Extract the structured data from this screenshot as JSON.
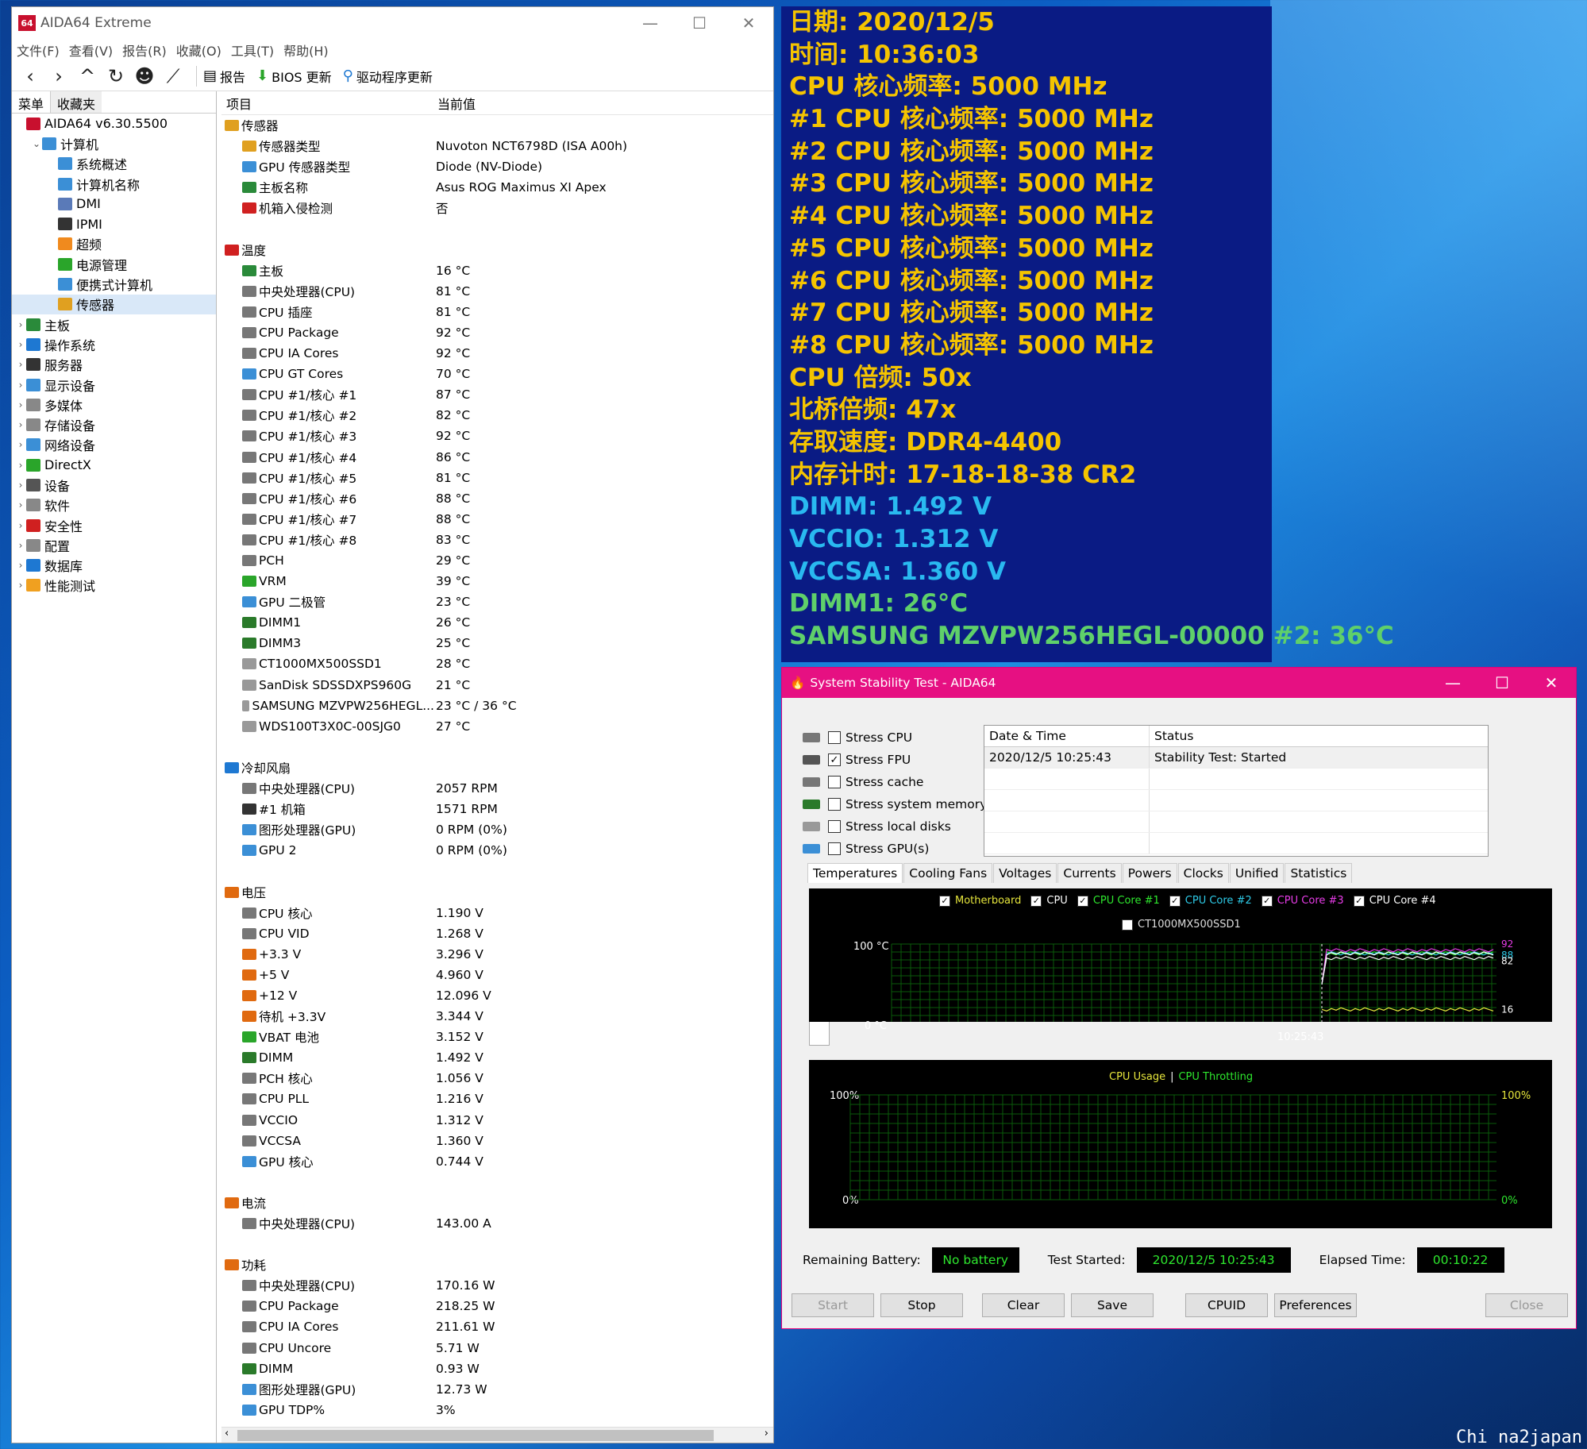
{
  "aida": {
    "title": "AIDA64 Extreme",
    "logo": "64",
    "win_btns": [
      "—",
      "☐",
      "✕"
    ],
    "menu": [
      "文件(F)",
      "查看(V)",
      "报告(R)",
      "收藏(O)",
      "工具(T)",
      "帮助(H)"
    ],
    "toolbar": {
      "report": "报告",
      "bios": "BIOS 更新",
      "driver": "驱动程序更新"
    },
    "left_tabs": [
      "菜单",
      "收藏夹"
    ],
    "tree": [
      {
        "label": "AIDA64 v6.30.5500",
        "level": 0,
        "arrow": "",
        "icon": "#c8102e",
        "icon_name": "aida64-logo-icon"
      },
      {
        "label": "计算机",
        "level": 1,
        "arrow": "⌄",
        "icon": "#3b8fd6",
        "icon_name": "computer-icon"
      },
      {
        "label": "系统概述",
        "level": 2,
        "arrow": "",
        "icon": "#3b8fd6",
        "icon_name": "computer-icon"
      },
      {
        "label": "计算机名称",
        "level": 2,
        "arrow": "",
        "icon": "#3b8fd6",
        "icon_name": "computer-icon"
      },
      {
        "label": "DMI",
        "level": 2,
        "arrow": "",
        "icon": "#5a7ab8",
        "icon_name": "dmi-icon"
      },
      {
        "label": "IPMI",
        "level": 2,
        "arrow": "",
        "icon": "#333",
        "icon_name": "ipmi-icon"
      },
      {
        "label": "超频",
        "level": 2,
        "arrow": "",
        "icon": "#f08a1e",
        "icon_name": "flame-icon"
      },
      {
        "label": "电源管理",
        "level": 2,
        "arrow": "",
        "icon": "#2aa52a",
        "icon_name": "battery-icon"
      },
      {
        "label": "便携式计算机",
        "level": 2,
        "arrow": "",
        "icon": "#3b8fd6",
        "icon_name": "laptop-icon"
      },
      {
        "label": "传感器",
        "level": 2,
        "arrow": "",
        "icon": "#e0a020",
        "icon_name": "sensor-icon",
        "selected": true
      },
      {
        "label": "主板",
        "level": 0,
        "arrow": "›",
        "icon": "#2a8a3a",
        "icon_name": "motherboard-icon"
      },
      {
        "label": "操作系统",
        "level": 0,
        "arrow": "›",
        "icon": "#1e78d2",
        "icon_name": "windows-icon"
      },
      {
        "label": "服务器",
        "level": 0,
        "arrow": "›",
        "icon": "#333",
        "icon_name": "server-icon"
      },
      {
        "label": "显示设备",
        "level": 0,
        "arrow": "›",
        "icon": "#3b8fd6",
        "icon_name": "monitor-icon"
      },
      {
        "label": "多媒体",
        "level": 0,
        "arrow": "›",
        "icon": "#888",
        "icon_name": "speaker-icon"
      },
      {
        "label": "存储设备",
        "level": 0,
        "arrow": "›",
        "icon": "#888",
        "icon_name": "disk-icon"
      },
      {
        "label": "网络设备",
        "level": 0,
        "arrow": "›",
        "icon": "#3b8fd6",
        "icon_name": "network-icon"
      },
      {
        "label": "DirectX",
        "level": 0,
        "arrow": "›",
        "icon": "#2aa52a",
        "icon_name": "directx-icon"
      },
      {
        "label": "设备",
        "level": 0,
        "arrow": "›",
        "icon": "#555",
        "icon_name": "device-icon"
      },
      {
        "label": "软件",
        "level": 0,
        "arrow": "›",
        "icon": "#888",
        "icon_name": "software-icon"
      },
      {
        "label": "安全性",
        "level": 0,
        "arrow": "›",
        "icon": "#d02020",
        "icon_name": "shield-icon"
      },
      {
        "label": "配置",
        "level": 0,
        "arrow": "›",
        "icon": "#888",
        "icon_name": "config-icon"
      },
      {
        "label": "数据库",
        "level": 0,
        "arrow": "›",
        "icon": "#1e78d2",
        "icon_name": "database-icon"
      },
      {
        "label": "性能测试",
        "level": 0,
        "arrow": "›",
        "icon": "#f0a020",
        "icon_name": "benchmark-icon"
      }
    ],
    "col_headers": [
      "项目",
      "当前值"
    ],
    "rows": [
      {
        "t": "sec",
        "n": "传感器",
        "v": "",
        "c": "#e0a020",
        "icon_name": "sensor-icon"
      },
      {
        "t": "item",
        "n": "传感器类型",
        "v": "Nuvoton NCT6798D  (ISA A00h)",
        "c": "#e0a020",
        "icon_name": "sensor-icon"
      },
      {
        "t": "item",
        "n": "GPU 传感器类型",
        "v": "Diode  (NV-Diode)",
        "c": "#3b8fd6",
        "icon_name": "gpu-icon"
      },
      {
        "t": "item",
        "n": "主板名称",
        "v": "Asus ROG Maximus XI Apex",
        "c": "#2a8a3a",
        "icon_name": "motherboard-icon"
      },
      {
        "t": "item",
        "n": "机箱入侵检测",
        "v": "否",
        "c": "#d02020",
        "icon_name": "shield-icon"
      },
      {
        "t": "gap"
      },
      {
        "t": "sec",
        "n": "温度",
        "v": "",
        "c": "#d02020",
        "icon_name": "thermometer-icon"
      },
      {
        "t": "item",
        "n": "主板",
        "v": "16 °C",
        "c": "#2a8a3a",
        "icon_name": "motherboard-icon"
      },
      {
        "t": "item",
        "n": "中央处理器(CPU)",
        "v": "81 °C",
        "c": "#777",
        "icon_name": "cpu-icon"
      },
      {
        "t": "item",
        "n": "CPU 插座",
        "v": "81 °C",
        "c": "#777",
        "icon_name": "cpu-icon"
      },
      {
        "t": "item",
        "n": "CPU Package",
        "v": "92 °C",
        "c": "#777",
        "icon_name": "cpu-icon"
      },
      {
        "t": "item",
        "n": "CPU IA Cores",
        "v": "92 °C",
        "c": "#777",
        "icon_name": "cpu-icon"
      },
      {
        "t": "item",
        "n": "CPU GT Cores",
        "v": "70 °C",
        "c": "#3b8fd6",
        "icon_name": "gpu-icon"
      },
      {
        "t": "item",
        "n": "CPU #1/核心 #1",
        "v": "87 °C",
        "c": "#777",
        "icon_name": "cpu-icon"
      },
      {
        "t": "item",
        "n": "CPU #1/核心 #2",
        "v": "82 °C",
        "c": "#777",
        "icon_name": "cpu-icon"
      },
      {
        "t": "item",
        "n": "CPU #1/核心 #3",
        "v": "92 °C",
        "c": "#777",
        "icon_name": "cpu-icon"
      },
      {
        "t": "item",
        "n": "CPU #1/核心 #4",
        "v": "86 °C",
        "c": "#777",
        "icon_name": "cpu-icon"
      },
      {
        "t": "item",
        "n": "CPU #1/核心 #5",
        "v": "81 °C",
        "c": "#777",
        "icon_name": "cpu-icon"
      },
      {
        "t": "item",
        "n": "CPU #1/核心 #6",
        "v": "88 °C",
        "c": "#777",
        "icon_name": "cpu-icon"
      },
      {
        "t": "item",
        "n": "CPU #1/核心 #7",
        "v": "88 °C",
        "c": "#777",
        "icon_name": "cpu-icon"
      },
      {
        "t": "item",
        "n": "CPU #1/核心 #8",
        "v": "83 °C",
        "c": "#777",
        "icon_name": "cpu-icon"
      },
      {
        "t": "item",
        "n": "PCH",
        "v": "29 °C",
        "c": "#777",
        "icon_name": "chip-icon"
      },
      {
        "t": "item",
        "n": "VRM",
        "v": "39 °C",
        "c": "#2aa52a",
        "icon_name": "vrm-icon"
      },
      {
        "t": "item",
        "n": "GPU 二极管",
        "v": "23 °C",
        "c": "#3b8fd6",
        "icon_name": "gpu-icon"
      },
      {
        "t": "item",
        "n": "DIMM1",
        "v": "26 °C",
        "c": "#2a7a2a",
        "icon_name": "memory-icon"
      },
      {
        "t": "item",
        "n": "DIMM3",
        "v": "25 °C",
        "c": "#2a7a2a",
        "icon_name": "memory-icon"
      },
      {
        "t": "item",
        "n": "CT1000MX500SSD1",
        "v": "28 °C",
        "c": "#999",
        "icon_name": "disk-icon"
      },
      {
        "t": "item",
        "n": "SanDisk SDSSDXPS960G",
        "v": "21 °C",
        "c": "#999",
        "icon_name": "disk-icon"
      },
      {
        "t": "item",
        "n": "SAMSUNG MZVPW256HEGL...",
        "v": "23 °C / 36 °C",
        "c": "#999",
        "icon_name": "disk-icon"
      },
      {
        "t": "item",
        "n": "WDS100T3X0C-00SJG0",
        "v": "27 °C",
        "c": "#999",
        "icon_name": "disk-icon"
      },
      {
        "t": "gap"
      },
      {
        "t": "sec",
        "n": "冷却风扇",
        "v": "",
        "c": "#1e78d2",
        "icon_name": "fan-icon"
      },
      {
        "t": "item",
        "n": "中央处理器(CPU)",
        "v": "2057 RPM",
        "c": "#777",
        "icon_name": "cpu-icon"
      },
      {
        "t": "item",
        "n": "#1 机箱",
        "v": "1571 RPM",
        "c": "#333",
        "icon_name": "case-icon"
      },
      {
        "t": "item",
        "n": "图形处理器(GPU)",
        "v": "0 RPM  (0%)",
        "c": "#3b8fd6",
        "icon_name": "gpu-icon"
      },
      {
        "t": "item",
        "n": "GPU 2",
        "v": "0 RPM  (0%)",
        "c": "#3b8fd6",
        "icon_name": "gpu-icon"
      },
      {
        "t": "gap"
      },
      {
        "t": "sec",
        "n": "电压",
        "v": "",
        "c": "#e06a10",
        "icon_name": "voltage-icon"
      },
      {
        "t": "item",
        "n": "CPU 核心",
        "v": "1.190 V",
        "c": "#777",
        "icon_name": "cpu-icon"
      },
      {
        "t": "item",
        "n": "CPU VID",
        "v": "1.268 V",
        "c": "#777",
        "icon_name": "cpu-icon"
      },
      {
        "t": "item",
        "n": "+3.3 V",
        "v": "3.296 V",
        "c": "#e06a10",
        "icon_name": "voltage-icon"
      },
      {
        "t": "item",
        "n": "+5 V",
        "v": "4.960 V",
        "c": "#e06a10",
        "icon_name": "voltage-icon"
      },
      {
        "t": "item",
        "n": "+12 V",
        "v": "12.096 V",
        "c": "#e06a10",
        "icon_name": "voltage-icon"
      },
      {
        "t": "item",
        "n": "待机 +3.3V",
        "v": "3.344 V",
        "c": "#e06a10",
        "icon_name": "voltage-icon"
      },
      {
        "t": "item",
        "n": "VBAT 电池",
        "v": "3.152 V",
        "c": "#2aa52a",
        "icon_name": "battery-icon"
      },
      {
        "t": "item",
        "n": "DIMM",
        "v": "1.492 V",
        "c": "#2a7a2a",
        "icon_name": "memory-icon"
      },
      {
        "t": "item",
        "n": "PCH 核心",
        "v": "1.056 V",
        "c": "#777",
        "icon_name": "chip-icon"
      },
      {
        "t": "item",
        "n": "CPU PLL",
        "v": "1.216 V",
        "c": "#777",
        "icon_name": "cpu-icon"
      },
      {
        "t": "item",
        "n": "VCCIO",
        "v": "1.312 V",
        "c": "#777",
        "icon_name": "cpu-icon"
      },
      {
        "t": "item",
        "n": "VCCSA",
        "v": "1.360 V",
        "c": "#777",
        "icon_name": "cpu-icon"
      },
      {
        "t": "item",
        "n": "GPU 核心",
        "v": "0.744 V",
        "c": "#3b8fd6",
        "icon_name": "gpu-icon"
      },
      {
        "t": "gap"
      },
      {
        "t": "sec",
        "n": "电流",
        "v": "",
        "c": "#e06a10",
        "icon_name": "current-icon"
      },
      {
        "t": "item",
        "n": "中央处理器(CPU)",
        "v": "143.00 A",
        "c": "#777",
        "icon_name": "cpu-icon"
      },
      {
        "t": "gap"
      },
      {
        "t": "sec",
        "n": "功耗",
        "v": "",
        "c": "#e06a10",
        "icon_name": "power-icon"
      },
      {
        "t": "item",
        "n": "中央处理器(CPU)",
        "v": "170.16 W",
        "c": "#777",
        "icon_name": "cpu-icon"
      },
      {
        "t": "item",
        "n": "CPU Package",
        "v": "218.25 W",
        "c": "#777",
        "icon_name": "cpu-icon"
      },
      {
        "t": "item",
        "n": "CPU IA Cores",
        "v": "211.61 W",
        "c": "#777",
        "icon_name": "cpu-icon"
      },
      {
        "t": "item",
        "n": "CPU Uncore",
        "v": "5.71 W",
        "c": "#777",
        "icon_name": "cpu-icon"
      },
      {
        "t": "item",
        "n": "DIMM",
        "v": "0.93 W",
        "c": "#2a7a2a",
        "icon_name": "memory-icon"
      },
      {
        "t": "item",
        "n": "图形处理器(GPU)",
        "v": "12.73 W",
        "c": "#3b8fd6",
        "icon_name": "gpu-icon"
      },
      {
        "t": "item",
        "n": "GPU TDP%",
        "v": "3%",
        "c": "#3b8fd6",
        "icon_name": "gpu-icon"
      }
    ]
  },
  "osd": [
    {
      "text": "日期: 2020/12/5",
      "color": "#f5c400"
    },
    {
      "text": "时间: 10:36:03",
      "color": "#f5c400"
    },
    {
      "text": "CPU 核心频率: 5000 MHz",
      "color": "#f5c400"
    },
    {
      "text": "#1 CPU 核心频率: 5000 MHz",
      "color": "#f5c400"
    },
    {
      "text": "#2 CPU 核心频率: 5000 MHz",
      "color": "#f5c400"
    },
    {
      "text": "#3 CPU 核心频率: 5000 MHz",
      "color": "#f5c400"
    },
    {
      "text": "#4 CPU 核心频率: 5000 MHz",
      "color": "#f5c400"
    },
    {
      "text": "#5 CPU 核心频率: 5000 MHz",
      "color": "#f5c400"
    },
    {
      "text": "#6 CPU 核心频率: 5000 MHz",
      "color": "#f5c400"
    },
    {
      "text": "#7 CPU 核心频率: 5000 MHz",
      "color": "#f5c400"
    },
    {
      "text": "#8 CPU 核心频率: 5000 MHz",
      "color": "#f5c400"
    },
    {
      "text": "CPU 倍频: 50x",
      "color": "#f5c400"
    },
    {
      "text": "北桥倍频: 47x",
      "color": "#f5c400"
    },
    {
      "text": "存取速度: DDR4-4400",
      "color": "#f5c400"
    },
    {
      "text": "内存计时: 17-18-18-38 CR2",
      "color": "#f5c400"
    },
    {
      "text": "DIMM: 1.492 V",
      "color": "#29b9f0"
    },
    {
      "text": "VCCIO: 1.312 V",
      "color": "#29b9f0"
    },
    {
      "text": "VCCSA: 1.360 V",
      "color": "#29b9f0"
    },
    {
      "text": "DIMM1: 26°C",
      "color": "#5fd06a"
    },
    {
      "text": "SAMSUNG MZVPW256HEGL-00000 #2: 36°C",
      "color": "#5fd06a"
    }
  ],
  "sst": {
    "title": "System Stability Test - AIDA64",
    "win_btns": [
      "—",
      "☐",
      "✕"
    ],
    "options": [
      {
        "label": "Stress CPU",
        "checked": false,
        "icon": "#777",
        "icon_name": "cpu-icon"
      },
      {
        "label": "Stress FPU",
        "checked": true,
        "icon": "#555",
        "icon_name": "fpu-icon"
      },
      {
        "label": "Stress cache",
        "checked": false,
        "icon": "#777",
        "icon_name": "cache-icon"
      },
      {
        "label": "Stress system memory",
        "checked": false,
        "icon": "#2a7a2a",
        "icon_name": "memory-icon"
      },
      {
        "label": "Stress local disks",
        "checked": false,
        "icon": "#999",
        "icon_name": "disk-icon"
      },
      {
        "label": "Stress GPU(s)",
        "checked": false,
        "icon": "#3b8fd6",
        "icon_name": "gpu-icon"
      }
    ],
    "status_headers": [
      "Date & Time",
      "Status"
    ],
    "status_rows": [
      [
        "2020/12/5 10:25:43",
        "Stability Test: Started"
      ]
    ],
    "tabs": [
      "Temperatures",
      "Cooling Fans",
      "Voltages",
      "Currents",
      "Powers",
      "Clocks",
      "Unified",
      "Statistics"
    ],
    "temp_legend": [
      {
        "label": "Motherboard",
        "color": "#e6e63c"
      },
      {
        "label": "CPU",
        "color": "#ffffff"
      },
      {
        "label": "CPU Core #1",
        "color": "#2ee82e"
      },
      {
        "label": "CPU Core #2",
        "color": "#2ecbe8"
      },
      {
        "label": "CPU Core #3",
        "color": "#e83ce8"
      },
      {
        "label": "CPU Core #4",
        "color": "#ffffff"
      }
    ],
    "temp_legend2": "CT1000MX500SSD1",
    "temp_axis": {
      "top": "100 °C",
      "bottom": "0 °C",
      "time": "10:25:43"
    },
    "temp_right_labels": [
      "92",
      "88",
      "82",
      "16"
    ],
    "usage_legend": [
      "CPU Usage",
      "|",
      "CPU Throttling"
    ],
    "usage_axis": {
      "top": "100%",
      "bottom": "0%",
      "rtop": "100%",
      "rbottom": "0%"
    },
    "battery_label": "Remaining Battery:",
    "battery_value": "No battery",
    "started_label": "Test Started:",
    "started_value": "2020/12/5 10:25:43",
    "elapsed_label": "Elapsed Time:",
    "elapsed_value": "00:10:22",
    "buttons": [
      "Start",
      "Stop",
      "Clear",
      "Save",
      "CPUID",
      "Preferences",
      "Close"
    ]
  },
  "chart_data": {
    "type": "line",
    "title": "",
    "ylabel": "°C",
    "ylim": [
      0,
      100
    ],
    "x": [
      "10:25:43"
    ],
    "series": [
      {
        "name": "Motherboard",
        "values": [
          16
        ]
      },
      {
        "name": "CPU",
        "values": [
          82
        ]
      },
      {
        "name": "CPU Core #1",
        "values": [
          88
        ]
      },
      {
        "name": "CPU Core #2",
        "values": [
          88
        ]
      },
      {
        "name": "CPU Core #3",
        "values": [
          92
        ]
      },
      {
        "name": "CPU Core #4",
        "values": [
          88
        ]
      }
    ],
    "grid": true,
    "legend": "top"
  },
  "watermark": "Chi na2japan"
}
